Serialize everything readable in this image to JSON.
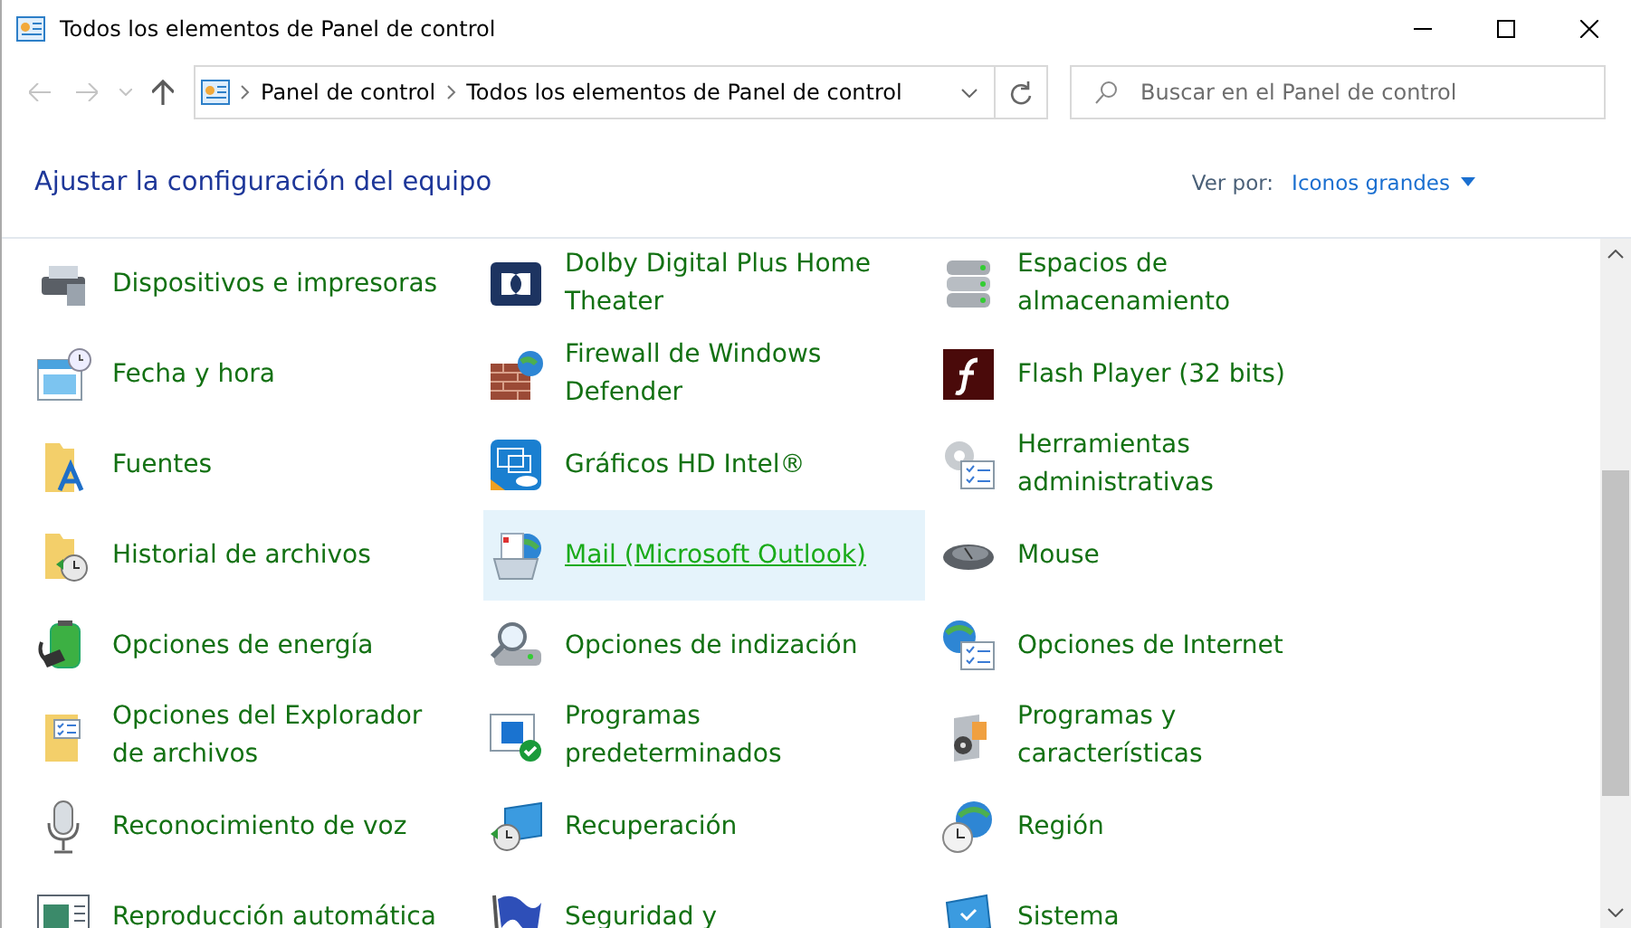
{
  "window": {
    "title": "Todos los elementos de Panel de control"
  },
  "address_bar": {
    "breadcrumbs": [
      "Panel de control",
      "Todos los elementos de Panel de control"
    ]
  },
  "search": {
    "placeholder": "Buscar en el Panel de control"
  },
  "header": {
    "title": "Ajustar la configuración del equipo",
    "view_label": "Ver por:",
    "view_value": "Iconos grandes"
  },
  "rows": [
    {
      "items": [
        {
          "label": "Dispositivos e impresoras",
          "highlighted": false
        },
        {
          "label": "Dolby Digital Plus Home\nTheater",
          "highlighted": false
        },
        {
          "label": "Espacios de\nalmacenamiento",
          "highlighted": false
        }
      ]
    },
    {
      "items": [
        {
          "label": "Fecha y hora",
          "highlighted": false
        },
        {
          "label": "Firewall de Windows\nDefender",
          "highlighted": false
        },
        {
          "label": "Flash Player (32 bits)",
          "highlighted": false
        }
      ]
    },
    {
      "items": [
        {
          "label": "Fuentes",
          "highlighted": false
        },
        {
          "label": "Gráficos HD Intel®",
          "highlighted": false
        },
        {
          "label": "Herramientas\nadministrativas",
          "highlighted": false
        }
      ]
    },
    {
      "items": [
        {
          "label": "Historial de archivos",
          "highlighted": false
        },
        {
          "label": "Mail (Microsoft Outlook)",
          "highlighted": true
        },
        {
          "label": "Mouse",
          "highlighted": false
        }
      ]
    },
    {
      "items": [
        {
          "label": "Opciones de energía",
          "highlighted": false
        },
        {
          "label": "Opciones de indización",
          "highlighted": false
        },
        {
          "label": "Opciones de Internet",
          "highlighted": false
        }
      ]
    },
    {
      "items": [
        {
          "label": "Opciones del Explorador\nde archivos",
          "highlighted": false
        },
        {
          "label": "Programas\npredeterminados",
          "highlighted": false
        },
        {
          "label": "Programas y\ncaracterísticas",
          "highlighted": false
        }
      ]
    },
    {
      "items": [
        {
          "label": "Reconocimiento de voz",
          "highlighted": false
        },
        {
          "label": "Recuperación",
          "highlighted": false
        },
        {
          "label": "Región",
          "highlighted": false
        }
      ]
    },
    {
      "items": [
        {
          "label": "Reproducción automática",
          "highlighted": false
        },
        {
          "label": "Seguridad y",
          "highlighted": false
        },
        {
          "label": "Sistema",
          "highlighted": false
        }
      ]
    }
  ]
}
